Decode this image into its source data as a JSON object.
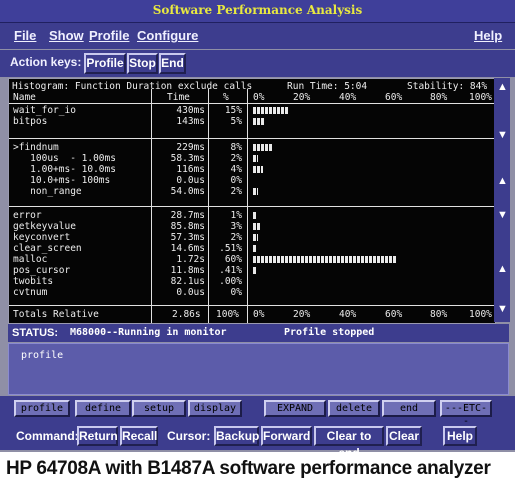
{
  "window": {
    "title": "Software Performance Analysis"
  },
  "menu": [
    "File",
    "Show",
    "Profile",
    "Configure",
    "Help"
  ],
  "action_keys": {
    "label": "Action keys:",
    "buttons": [
      "Profile",
      "Stop",
      "End"
    ]
  },
  "histogram": {
    "header": "Histogram: Function Duration exclude calls",
    "run_time": "Run Time: 5:04",
    "stability": "Stability: 84%",
    "col_name": "Name",
    "col_time": "Time",
    "col_pct": "%",
    "axis_labels": [
      "0%",
      "20%",
      "40%",
      "60%",
      "80%",
      "100%"
    ],
    "rows": [
      {
        "name": "wait_for_io",
        "time": "430ms",
        "pct": "15%",
        "value": 15
      },
      {
        "name": "bitpos",
        "time": "143ms",
        "pct": "5%",
        "value": 5
      },
      {
        "name": ">findnum",
        "time": "229ms",
        "pct": "8%",
        "value": 8
      },
      {
        "name": "   100us  - 1.00ms",
        "time": "58.3ms",
        "pct": "2%",
        "value": 2
      },
      {
        "name": "   1.00+ms- 10.0ms",
        "time": "116ms",
        "pct": "4%",
        "value": 4
      },
      {
        "name": "   10.0+ms- 100ms",
        "time": "0.0us",
        "pct": "0%",
        "value": 0
      },
      {
        "name": "   non_range",
        "time": "54.0ms",
        "pct": "2%",
        "value": 2
      },
      {
        "name": "error",
        "time": "28.7ms",
        "pct": "1%",
        "value": 1
      },
      {
        "name": "getkeyvalue",
        "time": "85.8ms",
        "pct": "3%",
        "value": 3
      },
      {
        "name": "keyconvert",
        "time": "57.3ms",
        "pct": "2%",
        "value": 2
      },
      {
        "name": "clear_screen",
        "time": "14.6ms",
        "pct": ".51%",
        "value": 0.51
      },
      {
        "name": "malloc",
        "time": "1.72s",
        "pct": "60%",
        "value": 60
      },
      {
        "name": "pos_cursor",
        "time": "11.8ms",
        "pct": ".41%",
        "value": 0.41
      },
      {
        "name": "twobits",
        "time": "82.1us",
        "pct": ".00%",
        "value": 0
      },
      {
        "name": "cvtnum",
        "time": "0.0us",
        "pct": "0%",
        "value": 0
      }
    ],
    "totals": {
      "label": "Totals Relative",
      "time": "2.86s",
      "pct": "100%"
    }
  },
  "status": {
    "label": "STATUS:",
    "text": "M68000--Running in monitor",
    "right": "Profile stopped"
  },
  "command_text": "profile",
  "softkeys": [
    "profile",
    "define",
    "setup",
    "display",
    "EXPAND",
    "delete",
    "end",
    "---ETC--"
  ],
  "command_bar": {
    "command_label": "Command:",
    "command_buttons": [
      "Return",
      "Recall"
    ],
    "cursor_label": "Cursor:",
    "cursor_buttons": [
      "Backup",
      "Forward",
      "Clear to end",
      "Clear"
    ],
    "help": "Help"
  },
  "caption": "HP 64708A with B1487A software performance analyzer"
}
